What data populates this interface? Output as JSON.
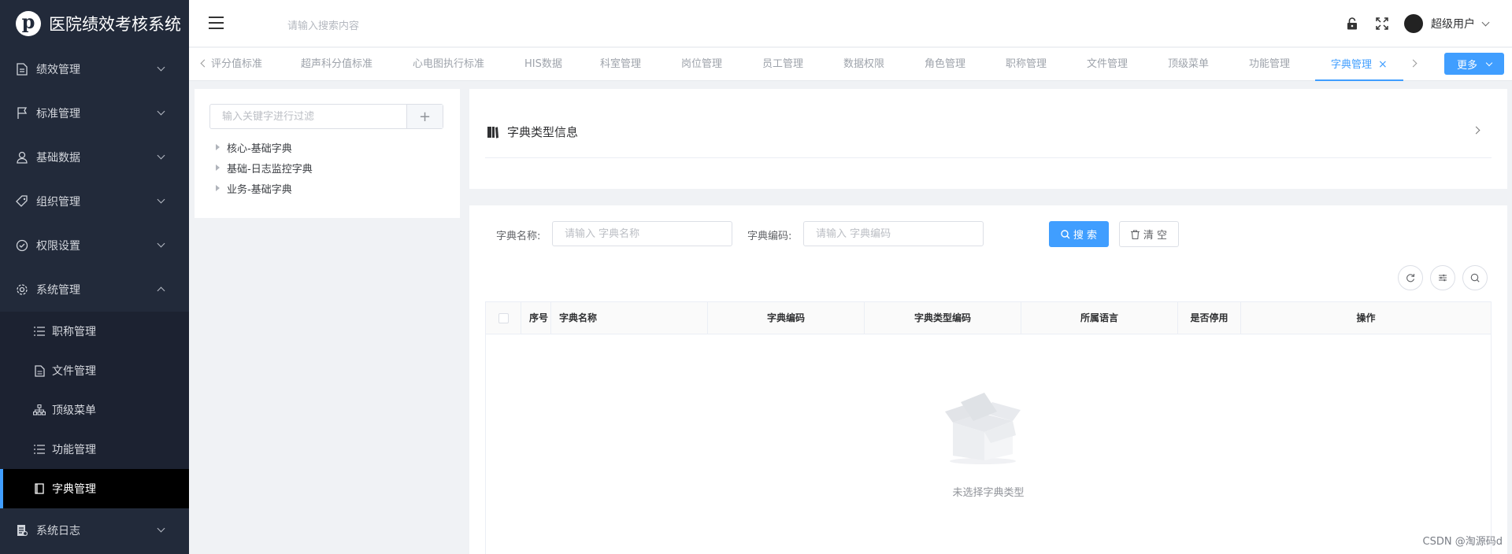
{
  "app": {
    "title": "医院绩效考核系统"
  },
  "sidebar": {
    "menus": [
      {
        "label": "绩效管理",
        "icon": "document-icon",
        "expanded": false
      },
      {
        "label": "标准管理",
        "icon": "flag-icon",
        "expanded": false
      },
      {
        "label": "基础数据",
        "icon": "user-icon",
        "expanded": false
      },
      {
        "label": "组织管理",
        "icon": "tag-icon",
        "expanded": false
      },
      {
        "label": "权限设置",
        "icon": "shield-check-icon",
        "expanded": false
      },
      {
        "label": "系统管理",
        "icon": "gear-icon",
        "expanded": true
      }
    ],
    "submenu": [
      {
        "label": "职称管理",
        "icon": "list-icon"
      },
      {
        "label": "文件管理",
        "icon": "file-icon"
      },
      {
        "label": "顶级菜单",
        "icon": "tree-icon"
      },
      {
        "label": "功能管理",
        "icon": "list-icon"
      },
      {
        "label": "字典管理",
        "icon": "book-icon",
        "active": true
      }
    ],
    "last_menu": {
      "label": "系统日志",
      "icon": "log-icon",
      "expanded": false
    }
  },
  "header": {
    "search_placeholder": "请输入搜索内容",
    "username": "超级用户"
  },
  "tabs": {
    "items": [
      "评分值标准",
      "超声科分值标准",
      "心电图执行标准",
      "HIS数据",
      "科室管理",
      "岗位管理",
      "员工管理",
      "数据权限",
      "角色管理",
      "职称管理",
      "文件管理",
      "顶级菜单",
      "功能管理"
    ],
    "active": "字典管理",
    "more_label": "更多"
  },
  "tree": {
    "filter_placeholder": "输入关键字进行过滤",
    "nodes": [
      "核心-基础字典",
      "基础-日志监控字典",
      "业务-基础字典"
    ]
  },
  "info_card": {
    "title": "字典类型信息"
  },
  "search_form": {
    "name_label": "字典名称:",
    "name_placeholder": "请输入 字典名称",
    "code_label": "字典编码:",
    "code_placeholder": "请输入 字典编码",
    "search_label": "搜 索",
    "clear_label": "清 空"
  },
  "table": {
    "columns": [
      "序号",
      "字典名称",
      "字典编码",
      "字典类型编码",
      "所属语言",
      "是否停用",
      "操作"
    ],
    "empty_text": "未选择字典类型"
  },
  "watermark": "CSDN @淘源码d",
  "colors": {
    "primary": "#409eff",
    "sidebar_bg": "#222a3a",
    "sidebar_active_bg": "#000000"
  }
}
